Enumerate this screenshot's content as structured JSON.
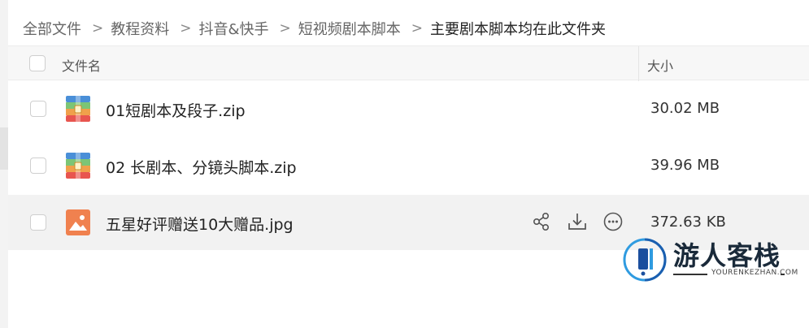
{
  "breadcrumb": [
    {
      "label": "全部文件"
    },
    {
      "label": "教程资料"
    },
    {
      "label": "抖音&快手"
    },
    {
      "label": "短视频剧本脚本"
    },
    {
      "label": "主要剧本脚本均在此文件夹",
      "current": true
    }
  ],
  "separator": ">",
  "table": {
    "columns": {
      "name": "文件名",
      "size": "大小"
    },
    "rows": [
      {
        "name": "01短剧本及段子.zip",
        "size": "30.02 MB",
        "icon": "zip-archive-icon"
      },
      {
        "name": "02 长剧本、分镜头脚本.zip",
        "size": "39.96 MB",
        "icon": "zip-archive-icon"
      },
      {
        "name": "五星好评赠送10大赠品.jpg",
        "size": "372.63 KB",
        "icon": "image-file-icon",
        "hovered": true,
        "actions": [
          "share-icon",
          "download-icon",
          "more-icon"
        ]
      }
    ]
  },
  "watermark": {
    "brand": "游人客栈",
    "domain": "YOURENKEZHAN.COM"
  },
  "colors": {
    "zip_blue": "#4a8fd8",
    "zip_green": "#7cc576",
    "zip_orange": "#f0a04b",
    "zip_red": "#e8554f",
    "image_orange": "#f0814f",
    "row_hover": "#f2f2f2",
    "header_bg": "#f7f7f7"
  }
}
